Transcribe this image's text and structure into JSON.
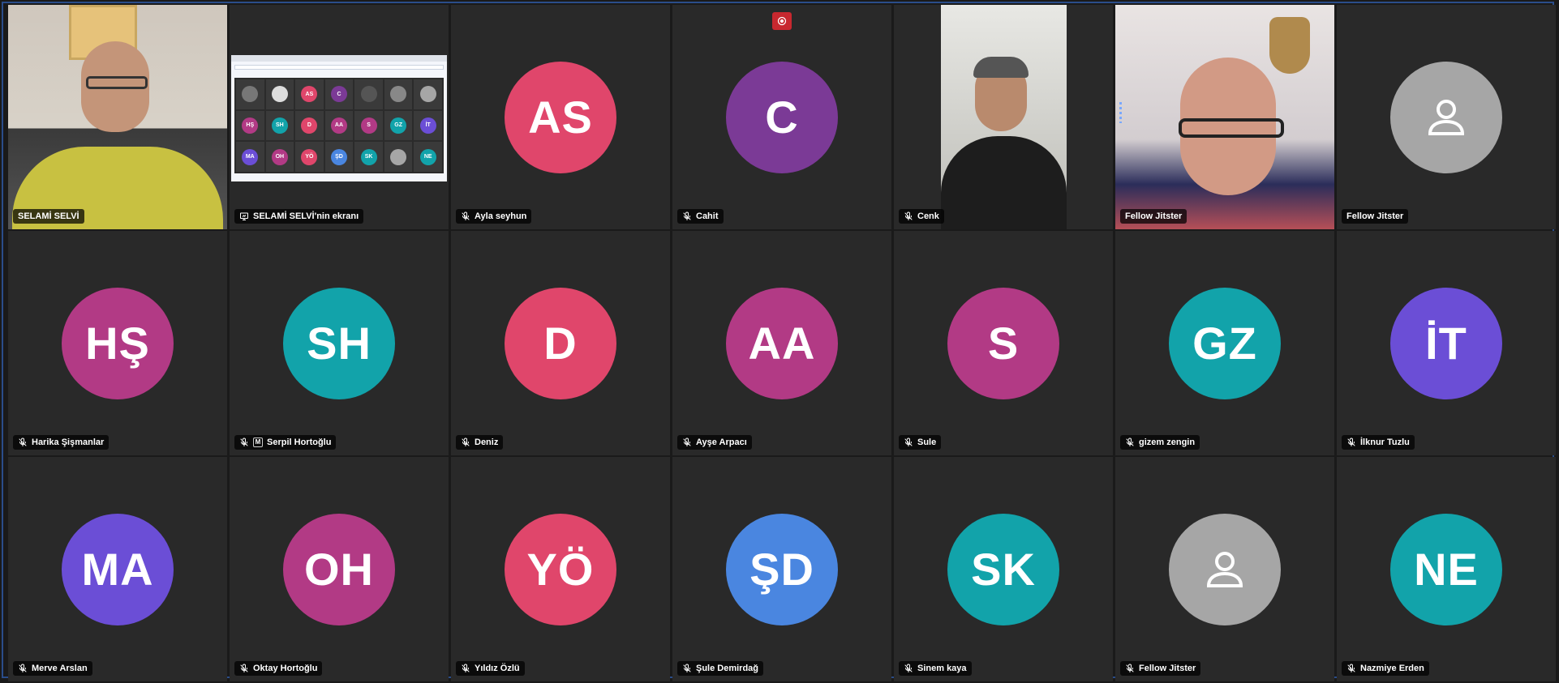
{
  "colors": {
    "tile_bg": "#292929",
    "frame_border": "#2a4d8a",
    "active_border": "#4a8cff",
    "record": "#c8282f"
  },
  "participants": [
    {
      "name": "SELAMİ SELVİ",
      "type": "video",
      "muted": false
    },
    {
      "name": "SELAMİ SELVİ'nin ekranı",
      "type": "screen-share"
    },
    {
      "name": "Ayla seyhun",
      "type": "avatar",
      "initials": "AS",
      "color": "#e0466b",
      "muted": true
    },
    {
      "name": "Cahit",
      "type": "avatar",
      "initials": "C",
      "color": "#7b3a96",
      "muted": true
    },
    {
      "name": "Cenk",
      "type": "video",
      "muted": true
    },
    {
      "name": "Fellow Jitster",
      "type": "video",
      "muted": false,
      "active": true
    },
    {
      "name": "Fellow Jitster",
      "type": "placeholder",
      "color": "#a6a6a6",
      "muted": false
    },
    {
      "name": "Harika Şişmanlar",
      "type": "avatar",
      "initials": "HŞ",
      "color": "#b23a85",
      "muted": true
    },
    {
      "name": "Serpil Hortoğlu",
      "type": "avatar",
      "initials": "SH",
      "color": "#12a3aa",
      "muted": true,
      "moderator": true
    },
    {
      "name": "Deniz",
      "type": "avatar",
      "initials": "D",
      "color": "#e0466b",
      "muted": true
    },
    {
      "name": "Ayşe Arpacı",
      "type": "avatar",
      "initials": "AA",
      "color": "#b23a85",
      "muted": true
    },
    {
      "name": "Sule",
      "type": "avatar",
      "initials": "S",
      "color": "#b23a85",
      "muted": true
    },
    {
      "name": "gizem zengin",
      "type": "avatar",
      "initials": "GZ",
      "color": "#12a3aa",
      "muted": true
    },
    {
      "name": "İlknur Tuzlu",
      "type": "avatar",
      "initials": "İT",
      "color": "#6b4ed6",
      "muted": true
    },
    {
      "name": "Merve Arslan",
      "type": "avatar",
      "initials": "MA",
      "color": "#6b4ed6",
      "muted": true
    },
    {
      "name": "Oktay Hortoğlu",
      "type": "avatar",
      "initials": "OH",
      "color": "#b23a85",
      "muted": true
    },
    {
      "name": "Yıldız Özlü",
      "type": "avatar",
      "initials": "YÖ",
      "color": "#e0466b",
      "muted": true
    },
    {
      "name": "Şule Demirdağ",
      "type": "avatar",
      "initials": "ŞD",
      "color": "#4a86e0",
      "muted": true
    },
    {
      "name": "Sinem kaya",
      "type": "avatar",
      "initials": "SK",
      "color": "#12a3aa",
      "muted": true
    },
    {
      "name": "Fellow Jitster",
      "type": "placeholder",
      "color": "#a6a6a6",
      "muted": true
    },
    {
      "name": "Nazmiye Erden",
      "type": "avatar",
      "initials": "NE",
      "color": "#12a3aa",
      "muted": true
    }
  ],
  "moderator_badge": "M",
  "recording": {
    "active": true,
    "icon": "record-icon"
  },
  "share_thumb": {
    "tiles": [
      {
        "i": "",
        "c": "#777"
      },
      {
        "i": "",
        "c": "#ddd"
      },
      {
        "i": "AS",
        "c": "#e0466b"
      },
      {
        "i": "C",
        "c": "#7b3a96"
      },
      {
        "i": "",
        "c": "#555"
      },
      {
        "i": "",
        "c": "#888"
      },
      {
        "i": "",
        "c": "#a6a6a6"
      },
      {
        "i": "HŞ",
        "c": "#b23a85"
      },
      {
        "i": "SH",
        "c": "#12a3aa"
      },
      {
        "i": "D",
        "c": "#e0466b"
      },
      {
        "i": "AA",
        "c": "#b23a85"
      },
      {
        "i": "S",
        "c": "#b23a85"
      },
      {
        "i": "GZ",
        "c": "#12a3aa"
      },
      {
        "i": "İT",
        "c": "#6b4ed6"
      },
      {
        "i": "MA",
        "c": "#6b4ed6"
      },
      {
        "i": "OH",
        "c": "#b23a85"
      },
      {
        "i": "YÖ",
        "c": "#e0466b"
      },
      {
        "i": "ŞD",
        "c": "#4a86e0"
      },
      {
        "i": "SK",
        "c": "#12a3aa"
      },
      {
        "i": "",
        "c": "#a6a6a6"
      },
      {
        "i": "NE",
        "c": "#12a3aa"
      }
    ]
  }
}
